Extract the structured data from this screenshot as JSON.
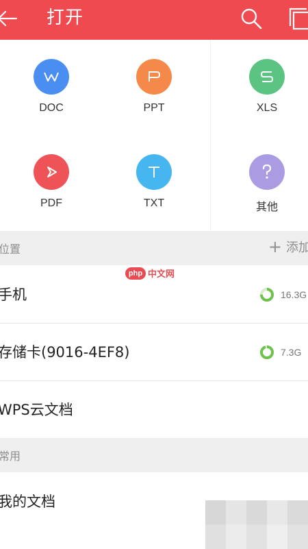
{
  "header": {
    "title": "打开",
    "back_icon": "arrow-left-icon",
    "search_icon": "search-icon",
    "multi_icon": "multi-window-icon",
    "bg_color": "#ee4a4f"
  },
  "file_types": [
    {
      "label": "DOC",
      "glyph": "W",
      "color": "#4b8ef2",
      "icon": "doc-icon"
    },
    {
      "label": "PPT",
      "glyph": "P",
      "color": "#f5894a",
      "icon": "ppt-icon"
    },
    {
      "label": "XLS",
      "glyph": "S",
      "color": "#5bc483",
      "icon": "xls-icon"
    },
    {
      "label": "PDF",
      "glyph": "pdf-arrow",
      "color": "#ee5457",
      "icon": "pdf-icon"
    },
    {
      "label": "TXT",
      "glyph": "T",
      "color": "#45b6f0",
      "icon": "txt-icon"
    },
    {
      "label": "其他",
      "glyph": "?",
      "color": "#ab9be2",
      "icon": "other-icon"
    }
  ],
  "locations": {
    "section_title": "位置",
    "add_label": "添加",
    "items": [
      {
        "name": "手机",
        "size": "16.3G",
        "used_fraction": 0.75
      },
      {
        "name": "存储卡(9016-4EF8)",
        "size": "7.3G",
        "used_fraction": 0.95
      },
      {
        "name": "WPS云文档"
      }
    ]
  },
  "common": {
    "section_title": "常用",
    "items": [
      {
        "name": "我的文档"
      }
    ]
  },
  "watermark": {
    "logo": "php",
    "text": "中文网"
  },
  "colors": {
    "ring_green": "#6cc24a",
    "ring_track": "#d7eccd"
  }
}
